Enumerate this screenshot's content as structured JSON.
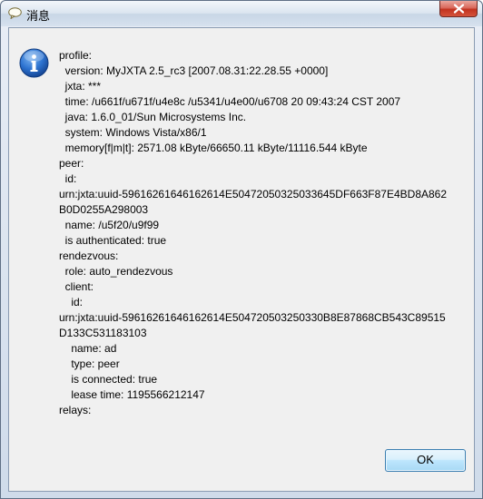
{
  "window": {
    "title": "消息",
    "close_label": "Close"
  },
  "dialog": {
    "icon": "info-icon",
    "lines": [
      "profile:",
      "  version: MyJXTA 2.5_rc3 [2007.08.31:22.28.55 +0000]",
      "  jxta: ***",
      "  time: /u661f/u671f/u4e8c /u5341/u4e00/u6708 20 09:43:24 CST 2007",
      "  java: 1.6.0_01/Sun Microsystems Inc.",
      "  system: Windows Vista/x86/1",
      "  memory[f|m|t]: 2571.08 kByte/66650.11 kByte/11116.544 kByte",
      "peer:",
      "  id:",
      "urn:jxta:uuid-59616261646162614E50472050325033645DF663F87E4BD8A862",
      "B0D0255A298003",
      "  name: /u5f20/u9f99",
      "  is authenticated: true",
      "rendezvous:",
      "  role: auto_rendezvous",
      "  client:",
      "    id:",
      "urn:jxta:uuid-59616261646162614E504720503250330B8E87868CB543C89515",
      "D133C531183103",
      "    name: ad",
      "    type: peer",
      "    is connected: true",
      "    lease time: 1195566212147",
      "relays:"
    ],
    "ok_label": "OK"
  },
  "colors": {
    "titlebar": "#dbe5f0",
    "client_bg": "#f0f0f0",
    "close_red": "#c2321f",
    "info_blue": "#1f5fb8"
  }
}
